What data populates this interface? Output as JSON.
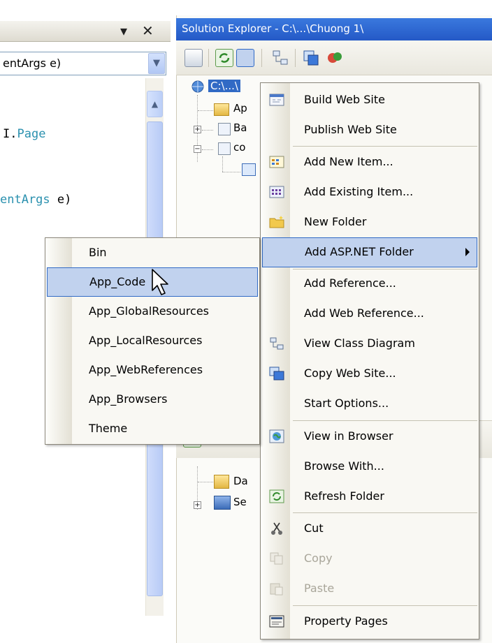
{
  "editor": {
    "combo_value": "entArgs e)",
    "code_line_1_prefix": "I.",
    "code_line_1_type": "Page",
    "code_line_2_type": "entArgs",
    "code_line_2_rest": " e)"
  },
  "solution_explorer": {
    "title": "Solution Explorer - C:\\...\\Chuong 1\\",
    "tree_items": [
      {
        "label": "C:\\...\\"
      },
      {
        "label": "Ap"
      },
      {
        "label": "Ba"
      },
      {
        "label": "co"
      }
    ],
    "lower_tree_items": [
      {
        "label": "Da"
      },
      {
        "label": "Se"
      }
    ]
  },
  "context_menu": {
    "items": [
      {
        "label": "Build Web Site",
        "icon": "build-web-site-icon"
      },
      {
        "label": "Publish Web Site"
      },
      {
        "label": "Add New Item...",
        "icon": "add-new-item-icon"
      },
      {
        "label": "Add Existing Item...",
        "icon": "add-existing-item-icon"
      },
      {
        "label": "New Folder",
        "icon": "new-folder-icon"
      },
      {
        "label": "Add ASP.NET Folder",
        "highlighted": true,
        "has_submenu": true
      },
      {
        "label": "Add Reference..."
      },
      {
        "label": "Add Web Reference..."
      },
      {
        "label": "View Class Diagram",
        "icon": "class-diagram-icon"
      },
      {
        "label": "Copy Web Site...",
        "icon": "copy-web-site-icon"
      },
      {
        "label": "Start Options..."
      },
      {
        "label": "View in Browser",
        "icon": "view-in-browser-icon"
      },
      {
        "label": "Browse With..."
      },
      {
        "label": "Refresh Folder",
        "icon": "refresh-icon"
      },
      {
        "label": "Cut",
        "icon": "scissors-icon"
      },
      {
        "label": "Copy",
        "icon": "copy-icon",
        "disabled": true
      },
      {
        "label": "Paste",
        "icon": "paste-icon",
        "disabled": true
      },
      {
        "label": "Property Pages",
        "icon": "property-pages-icon"
      }
    ]
  },
  "submenu": {
    "items": [
      {
        "label": "Bin"
      },
      {
        "label": "App_Code",
        "highlighted": true
      },
      {
        "label": "App_GlobalResources"
      },
      {
        "label": "App_LocalResources"
      },
      {
        "label": "App_WebReferences"
      },
      {
        "label": "App_Browsers"
      },
      {
        "label": "Theme"
      }
    ]
  },
  "colors": {
    "highlight_fill": "#c1d2ee",
    "highlight_border": "#316ac5",
    "title_bar": "#2f6bd6",
    "code_type": "#2b91af"
  }
}
